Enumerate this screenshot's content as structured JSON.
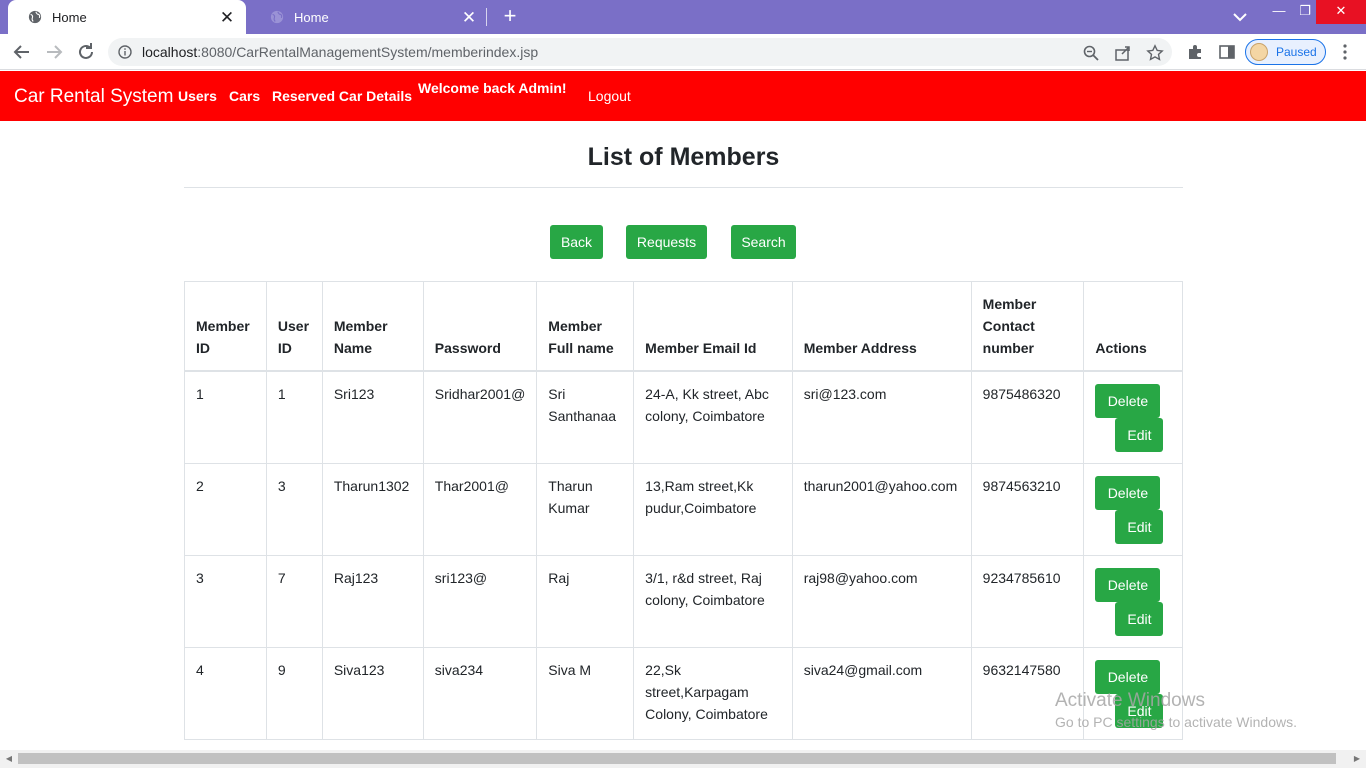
{
  "browser": {
    "tabs": [
      {
        "title": "Home",
        "active": true
      },
      {
        "title": "Home",
        "active": false
      }
    ],
    "url_host": "localhost",
    "url_rest": ":8080/CarRentalManagementSystem/memberindex.jsp",
    "profile_status": "Paused",
    "accent_color": "#7a6fc7"
  },
  "navbar": {
    "brand": "Car Rental System",
    "links": [
      "Users",
      "Cars",
      "Reserved Car Details"
    ],
    "welcome": "Welcome back Admin!",
    "logout": "Logout",
    "color": "#ff0000"
  },
  "page": {
    "title": "List of Members",
    "buttons": [
      "Back",
      "Requests",
      "Search"
    ],
    "button_color": "#28a745"
  },
  "table": {
    "headers": [
      "Member ID",
      "User ID",
      "Member Name",
      "Password",
      "Member Full name",
      "Member Email Id",
      "Member Address",
      "Member Contact number",
      "Actions"
    ],
    "rows": [
      [
        "1",
        "1",
        "Sri123",
        "Sridhar2001@",
        "Sri Santhanaa",
        "24-A, Kk street, Abc colony, Coimbatore",
        "sri@123.com",
        "9875486320"
      ],
      [
        "2",
        "3",
        "Tharun1302",
        "Thar2001@",
        "Tharun Kumar",
        "13,Ram street,Kk pudur,Coimbatore",
        "tharun2001@yahoo.com",
        "9874563210"
      ],
      [
        "3",
        "7",
        "Raj123",
        "sri123@",
        "Raj",
        "3/1, r&d street, Raj colony, Coimbatore",
        "raj98@yahoo.com",
        "9234785610"
      ],
      [
        "4",
        "9",
        "Siva123",
        "siva234",
        "Siva M",
        "22,Sk street,Karpagam Colony, Coimbatore",
        "siva24@gmail.com",
        "9632147580"
      ]
    ],
    "actions": {
      "delete": "Delete",
      "edit": "Edit"
    }
  },
  "watermark": {
    "title": "Activate Windows",
    "subtitle": "Go to PC settings to activate Windows."
  }
}
